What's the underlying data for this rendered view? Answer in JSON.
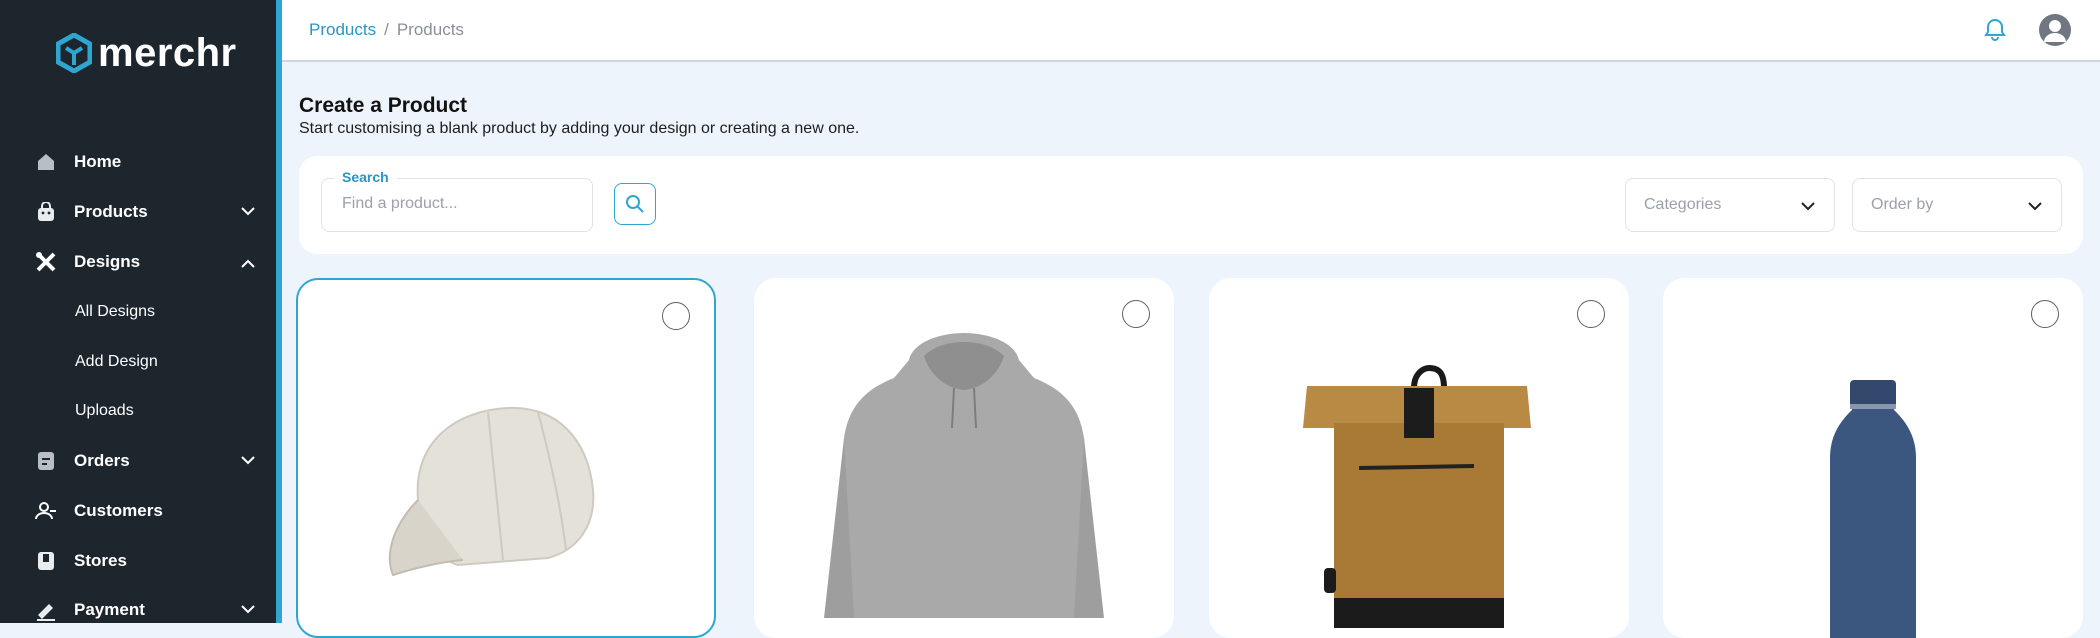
{
  "app": {
    "logo_text": "merchr",
    "accent_color": "#2ea6d1",
    "sidebar_color": "#1d252d"
  },
  "sidebar": {
    "items": [
      {
        "label": "Home",
        "icon": "home-icon"
      },
      {
        "label": "Products",
        "icon": "bag-icon",
        "chevron": "chevron-down-icon"
      },
      {
        "label": "Designs",
        "icon": "design-tools-icon",
        "chevron": "chevron-up-icon"
      },
      {
        "label": "Orders",
        "icon": "orders-icon",
        "chevron": "chevron-down-icon"
      },
      {
        "label": "Customers",
        "icon": "customers-icon"
      },
      {
        "label": "Stores",
        "icon": "store-icon"
      },
      {
        "label": "Payment",
        "icon": "payment-icon",
        "chevron": "chevron-down-icon"
      }
    ],
    "design_subitems": [
      {
        "label": "All Designs"
      },
      {
        "label": "Add Design"
      },
      {
        "label": "Uploads"
      }
    ]
  },
  "topbar": {
    "breadcrumb_link": "Products",
    "breadcrumb_sep": "/",
    "breadcrumb_current": "Products",
    "bell_icon": "bell-icon",
    "avatar_icon": "user-avatar-icon"
  },
  "main": {
    "title": "Create a Product",
    "subtitle": "Start customising a blank product by adding your design or creating a new one."
  },
  "filters": {
    "search_label": "Search",
    "search_placeholder": "Find a product...",
    "search_value": "",
    "categories_placeholder": "Categories",
    "order_by_placeholder": "Order by"
  },
  "products": [
    {
      "name": "cap",
      "selected": true,
      "image": "baseball-cap"
    },
    {
      "name": "hoodie",
      "selected": false,
      "image": "grey-hoodie"
    },
    {
      "name": "backpack",
      "selected": false,
      "image": "roll-top-backpack"
    },
    {
      "name": "bottle",
      "selected": false,
      "image": "navy-water-bottle"
    }
  ]
}
